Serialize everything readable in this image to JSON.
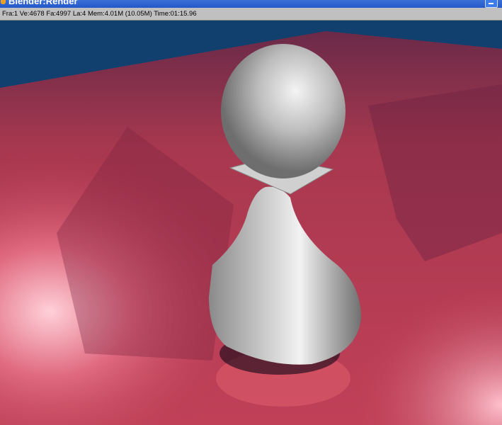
{
  "window": {
    "title": "Blender:Render"
  },
  "status": {
    "text": "Fra:1  Ve:4678 Fa:4997 La:4 Mem:4.01M (10.05M) Time:01:15.96"
  },
  "colors": {
    "titlebar": "#2457c8",
    "statusbar": "#c0c0c0",
    "floor": "#b83a52",
    "sky": "#12406e"
  }
}
